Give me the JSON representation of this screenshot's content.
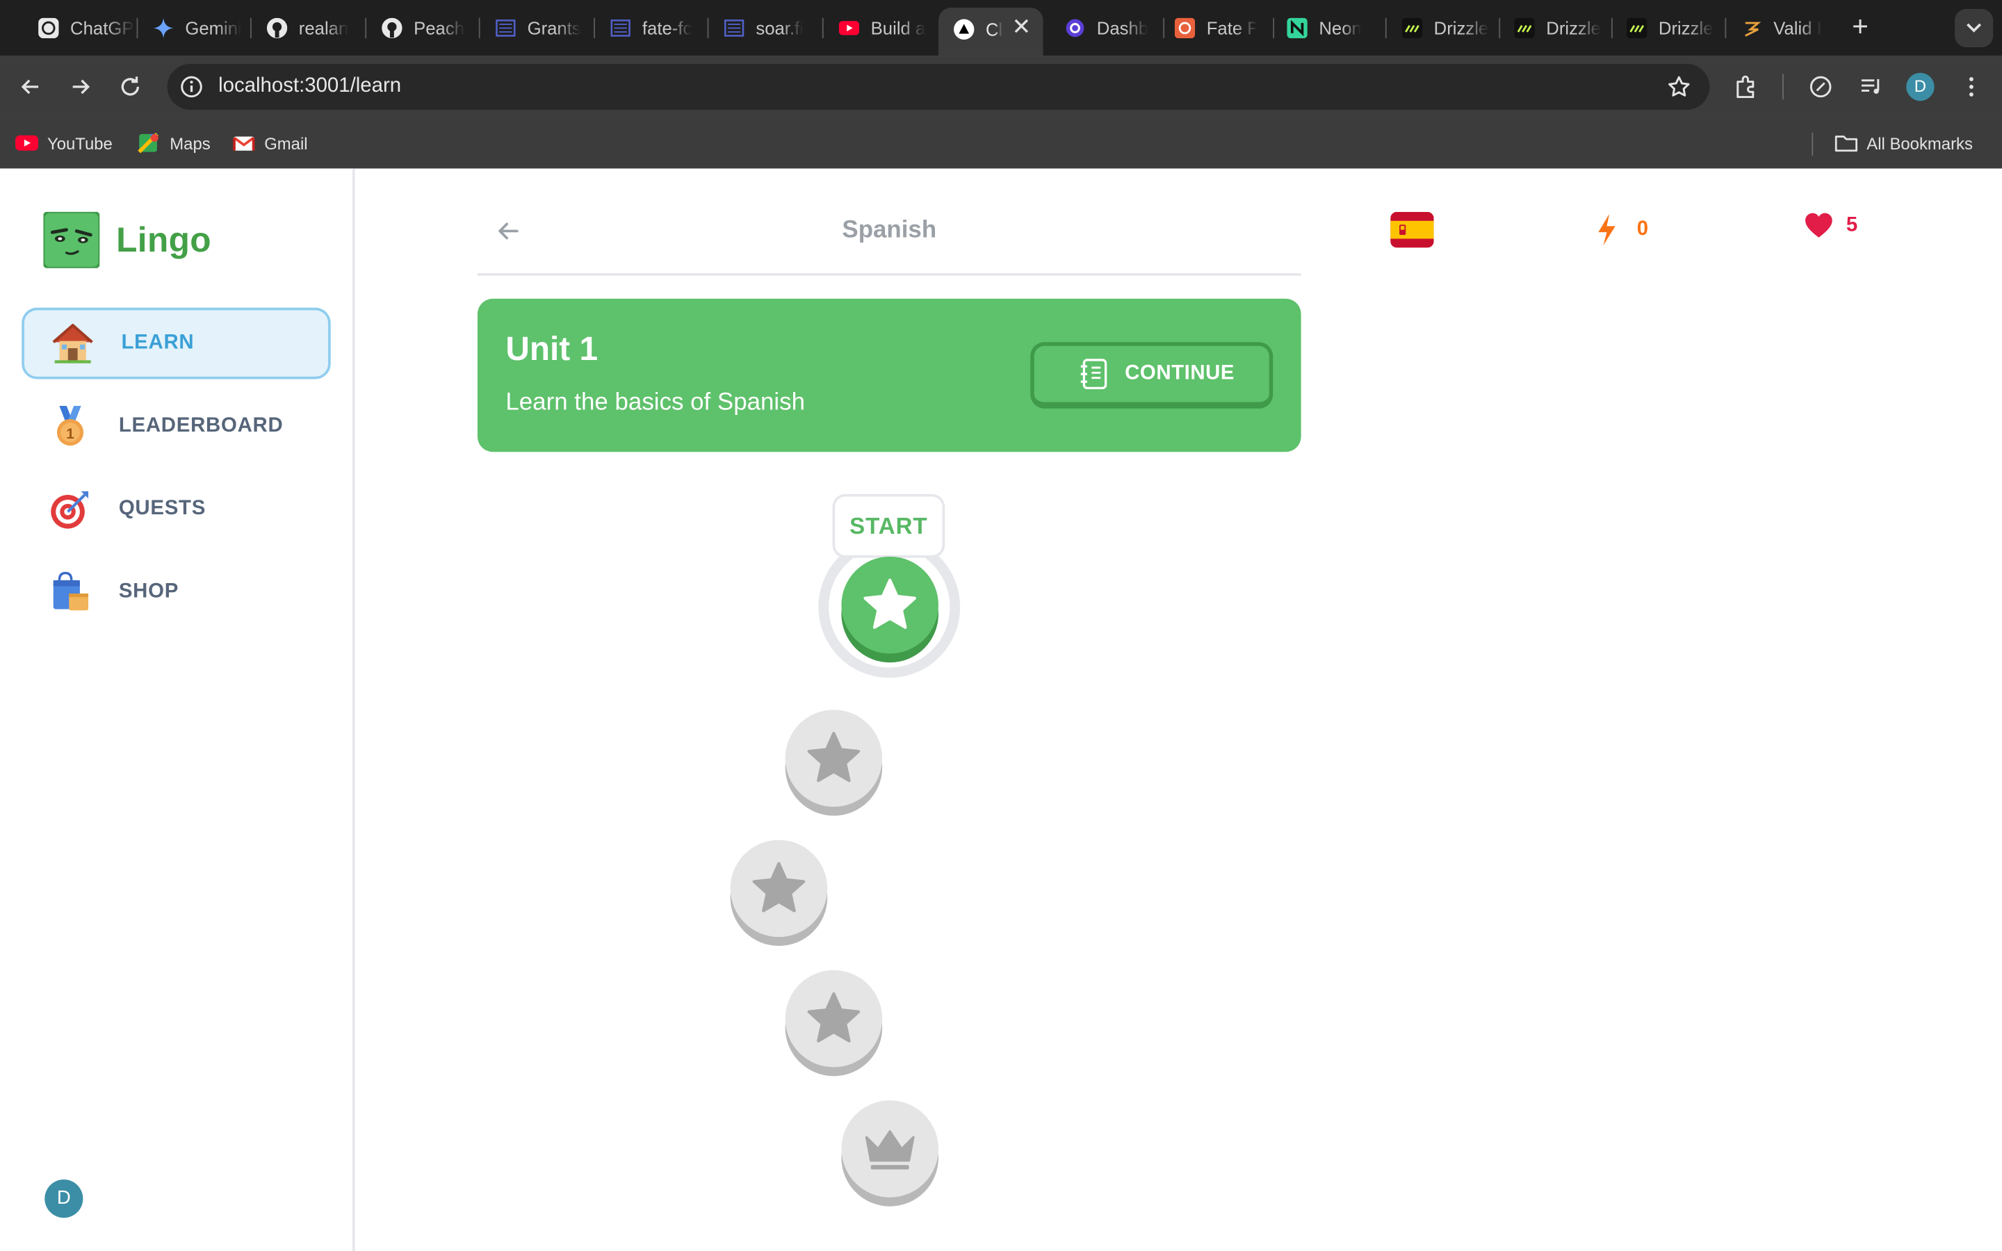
{
  "browser": {
    "tabs": [
      {
        "label": "ChatGPT",
        "icon": "chatgpt-icon"
      },
      {
        "label": "Gemini",
        "icon": "gemini-icon"
      },
      {
        "label": "realan",
        "icon": "github-icon"
      },
      {
        "label": "Peach",
        "icon": "github-icon"
      },
      {
        "label": "Grants",
        "icon": "grid-app-icon"
      },
      {
        "label": "fate-fc",
        "icon": "grid-app-icon"
      },
      {
        "label": "soar.fi",
        "icon": "grid-app-icon"
      },
      {
        "label": "Build a",
        "icon": "youtube-icon"
      },
      {
        "label": "Cl",
        "icon": "vercel-icon",
        "active": true
      },
      {
        "label": "Dashb",
        "icon": "clerk-icon"
      },
      {
        "label": "Fate F",
        "icon": "fate-icon"
      },
      {
        "label": "Neon",
        "icon": "neon-icon"
      },
      {
        "label": "Drizzle",
        "icon": "drizzle-icon"
      },
      {
        "label": "Drizzle",
        "icon": "drizzle-icon"
      },
      {
        "label": "Drizzle",
        "icon": "drizzle-icon"
      },
      {
        "label": "Valid I",
        "icon": "valid-icon"
      }
    ],
    "url": "localhost:3001/learn",
    "profile_initial": "D",
    "bookmarks": [
      {
        "label": "YouTube",
        "icon": "youtube-icon"
      },
      {
        "label": "Maps",
        "icon": "maps-icon"
      },
      {
        "label": "Gmail",
        "icon": "gmail-icon"
      }
    ],
    "all_bookmarks": "All Bookmarks"
  },
  "app": {
    "name": "Lingo",
    "nav": [
      {
        "label": "LEARN",
        "icon": "house-icon",
        "active": true
      },
      {
        "label": "LEADERBOARD",
        "icon": "medal-icon"
      },
      {
        "label": "QUESTS",
        "icon": "target-icon"
      },
      {
        "label": "SHOP",
        "icon": "shopping-bag-icon"
      }
    ],
    "user_initial": "D"
  },
  "header": {
    "title": "Spanish",
    "flag": "spain-flag-icon",
    "points": "0",
    "hearts": "5"
  },
  "unit": {
    "title": "Unit 1",
    "description": "Learn the basics of Spanish",
    "button_label": "CONTINUE"
  },
  "lessons": {
    "start_label": "START",
    "items": [
      {
        "status": "current",
        "icon": "star-icon"
      },
      {
        "status": "locked",
        "icon": "star-icon"
      },
      {
        "status": "locked",
        "icon": "star-icon"
      },
      {
        "status": "locked",
        "icon": "star-icon"
      },
      {
        "status": "locked",
        "icon": "crown-icon"
      }
    ]
  },
  "colors": {
    "primary_green": "#5ec16b",
    "active_nav_blue": "#3aa0d6",
    "points_orange": "#f97316",
    "hearts_red": "#e11d48"
  }
}
